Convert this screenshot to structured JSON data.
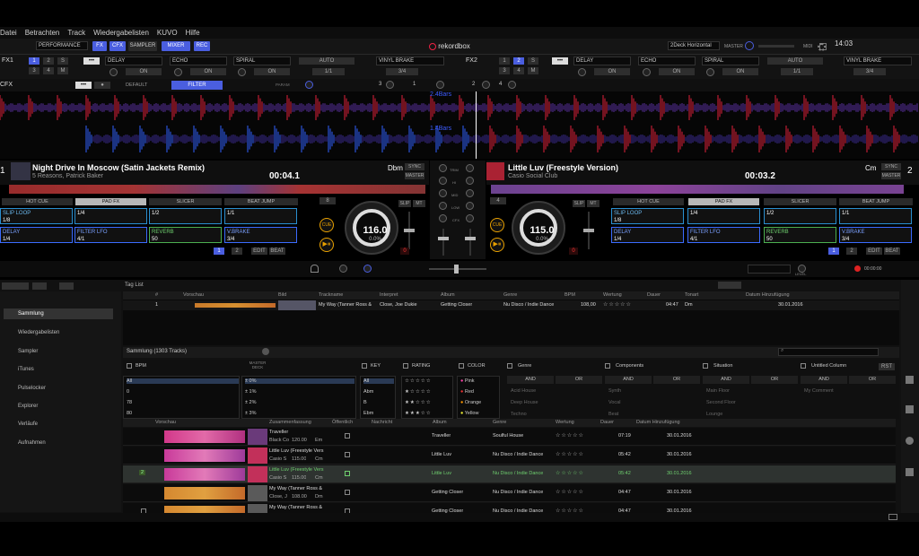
{
  "menu": [
    "Datei",
    "Betrachten",
    "Track",
    "Wiedergabelisten",
    "KUVO",
    "Hilfe"
  ],
  "toolbar": {
    "mode": "PERFORMANCE",
    "buttons": [
      "FX",
      "CFX",
      "SAMPLER",
      "MIXER",
      "REC"
    ],
    "logo": "rekordbox",
    "layout": "2Deck Horizontal",
    "master_label": "MASTER",
    "midi_label": "MIDI",
    "clock": "14:03"
  },
  "fx1": {
    "label": "FX1",
    "unit_buttons": [
      "1",
      "2",
      "S",
      "3",
      "4",
      "M"
    ],
    "effects": [
      "DELAY",
      "ECHO",
      "SPIRAL"
    ],
    "on_label": "ON",
    "auto_label": "AUTO",
    "beat_value": "1/1",
    "vinyl": "VINYL BRAKE",
    "vinyl_value": "3/4"
  },
  "fx2": {
    "label": "FX2",
    "unit_buttons": [
      "1",
      "2",
      "S",
      "3",
      "4",
      "M"
    ],
    "effects": [
      "DELAY",
      "ECHO",
      "SPIRAL"
    ],
    "on_label": "ON",
    "auto_label": "AUTO",
    "beat_value": "1/1",
    "vinyl": "VINYL BRAKE",
    "vinyl_value": "3/4"
  },
  "cfx": {
    "label": "CFX",
    "default": "DEFAULT",
    "filter": "FILTER",
    "param": "PARAM",
    "nums": [
      "3",
      "1",
      "2",
      "4"
    ]
  },
  "wave_labels": {
    "top": "2.4Bars",
    "bottom": "1.4Bars"
  },
  "deck1": {
    "num": "1",
    "title": "Night Drive In Moscow (Satin Jackets Remix)",
    "artist": "5 Reasons, Patrick Baker",
    "time": "00:04.1",
    "key": "Dbm",
    "sync": "SYNC",
    "master": "MASTER",
    "bpm": "116.0",
    "pitch": "0.0%",
    "tabs": [
      "HOT CUE",
      "PAD FX",
      "SLICER",
      "BEAT JUMP"
    ],
    "pads": [
      {
        "name": "SLIP LOOP",
        "val": "1/8"
      },
      {
        "name": "",
        "val": "1/4"
      },
      {
        "name": "",
        "val": "1/2"
      },
      {
        "name": "",
        "val": "1/1"
      },
      {
        "name": "DELAY",
        "val": "1/4"
      },
      {
        "name": "FILTER LFO",
        "val": "4/1"
      },
      {
        "name": "REVERB",
        "val": "50"
      },
      {
        "name": "V.BRAKE",
        "val": "3/4"
      }
    ],
    "cue": "CUE",
    "slip": "SLIP",
    "mt": "MT",
    "edit": "EDIT",
    "beat": "BEAT",
    "page": [
      "1",
      "2"
    ],
    "beat_num": "8"
  },
  "deck2": {
    "num": "2",
    "title": "Little Luv (Freestyle Version)",
    "artist": "Casio Social Club",
    "time": "00:03.2",
    "key": "Cm",
    "sync": "SYNC",
    "master": "MASTER",
    "bpm": "115.0",
    "pitch": "0.0%",
    "tabs": [
      "HOT CUE",
      "PAD FX",
      "SLICER",
      "BEAT JUMP"
    ],
    "pads": [
      {
        "name": "SLIP LOOP",
        "val": "1/8"
      },
      {
        "name": "",
        "val": "1/4"
      },
      {
        "name": "",
        "val": "1/2"
      },
      {
        "name": "",
        "val": "1/1"
      },
      {
        "name": "DELAY",
        "val": "1/4"
      },
      {
        "name": "FILTER LFO",
        "val": "4/1"
      },
      {
        "name": "REVERB",
        "val": "50"
      },
      {
        "name": "V.BRAKE",
        "val": "3/4"
      }
    ],
    "cue": "CUE",
    "slip": "SLIP",
    "mt": "MT",
    "edit": "EDIT",
    "beat": "BEAT",
    "page": [
      "1",
      "2"
    ],
    "beat_num": "4"
  },
  "mixer": {
    "labels": [
      "TRIM",
      "HI",
      "MID",
      "LOW",
      "CFX"
    ]
  },
  "bottombar": {
    "level": "LEVEL",
    "time": "00:00:00"
  },
  "taglist": {
    "title": "Tag List",
    "headers": [
      "#",
      "Vorschau",
      "Bild",
      "Trackname",
      "Interpret",
      "Album",
      "Genre",
      "BPM",
      "Wertung",
      "Dauer",
      "Tonart",
      "Datum Hinzufügung"
    ],
    "row": {
      "num": "1",
      "track": "My Way (Tanner Ross &",
      "artist": "Close, Joe Dukie",
      "album": "Getting Closer",
      "genre": "Nu Disco / Indie Dance",
      "bpm": "108,00",
      "rating": "☆☆☆☆☆",
      "dur": "04:47",
      "key": "Dm",
      "date": "30.01.2016"
    }
  },
  "sidebar": {
    "items": [
      "Sammlung",
      "Wiedergabelisten",
      "Sampler",
      "iTunes",
      "Pulselocker",
      "Explorer",
      "Verläufe",
      "Aufnahmen"
    ]
  },
  "collection": {
    "title": "Sammlung (1303 Tracks)",
    "search_placeholder": "",
    "master_deck": "MASTER DECK",
    "filters": {
      "bpm": {
        "label": "BPM",
        "options": [
          "All",
          "0",
          "78",
          "80"
        ]
      },
      "percent": {
        "options": [
          "± 0%",
          "± 1%",
          "± 2%",
          "± 3%"
        ]
      },
      "key": {
        "label": "KEY",
        "options": [
          "All",
          "Abm",
          "B",
          "Ebm"
        ]
      },
      "rating": {
        "label": "RATING"
      },
      "color": {
        "label": "COLOR",
        "options": [
          "Pink",
          "Red",
          "Orange",
          "Yellow"
        ]
      },
      "genre": {
        "label": "Genre",
        "options": [
          "Acid House",
          "Deep House",
          "Techno"
        ]
      },
      "components": {
        "label": "Components",
        "options": [
          "Synth",
          "Vocal",
          "Beat"
        ]
      },
      "situation": {
        "label": "Situation",
        "options": [
          "Main Floor",
          "Second Floor",
          "Lounge"
        ]
      },
      "untitled": {
        "label": "Untitled Column",
        "options": [
          "My Comment"
        ]
      },
      "and": "AND",
      "or": "OR",
      "rst": "RST"
    },
    "headers": [
      "Vorschau",
      "Zusammenfassung",
      "Öffentlich",
      "Nachricht",
      "Album",
      "Genre",
      "Wertung",
      "Dauer",
      "Datum Hinzufügung"
    ],
    "rows": [
      {
        "title": "Traveller",
        "sub": "Black Co",
        "bpm": "120.00",
        "key": "Em",
        "album": "Traveller",
        "genre": "Soulful House",
        "rating": "☆☆☆☆☆",
        "dur": "07:19",
        "date": "30.01.2016"
      },
      {
        "title": "Little Luv (Freestyle Vers",
        "sub": "Casio S",
        "bpm": "115.00",
        "key": "Cm",
        "album": "Little Luv",
        "genre": "Nu Disco / Indie Dance",
        "rating": "☆☆☆☆☆",
        "dur": "05:42",
        "date": "30.01.2016"
      },
      {
        "title": "Little Luv (Freestyle Vers",
        "sub": "Casio S",
        "bpm": "115.00",
        "key": "Cm",
        "album": "Little Luv",
        "genre": "Nu Disco / Indie Dance",
        "rating": "☆☆☆☆☆",
        "dur": "05:42",
        "date": "30.01.2016",
        "num": "2"
      },
      {
        "title": "My Way (Tanner Ross &",
        "sub": "Close, J",
        "bpm": "108.00",
        "key": "Dm",
        "album": "Getting Closer",
        "genre": "Nu Disco / Indie Dance",
        "rating": "☆☆☆☆☆",
        "dur": "04:47",
        "date": "30.01.2016"
      },
      {
        "title": "My Way (Tanner Ross &",
        "sub": "",
        "bpm": "",
        "key": "",
        "album": "Getting Closer",
        "genre": "Nu Disco / Indie Dance",
        "rating": "☆☆☆☆☆",
        "dur": "04:47",
        "date": "30.01.2016"
      }
    ]
  },
  "colors": {
    "accent": "#4a5ee0",
    "cue": "#e8a000",
    "green": "#6fd06f",
    "wave_red": "#e0203a",
    "wave_blue": "#3060ff"
  }
}
